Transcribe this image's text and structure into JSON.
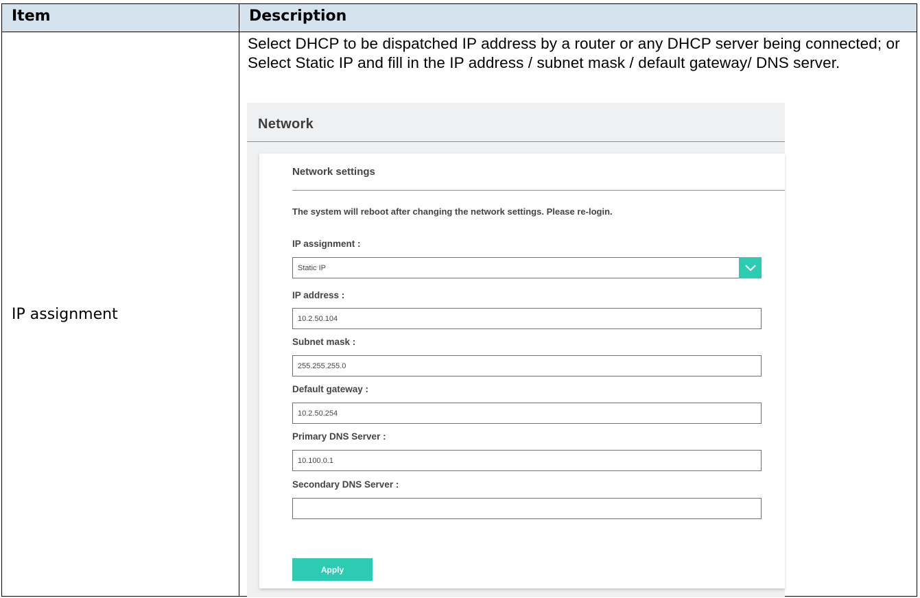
{
  "table": {
    "header_item": "Item",
    "header_description": "Description",
    "row_item": "IP assignment",
    "row_description": "Select DHCP to be dispatched IP address by a router or any DHCP server being connected; or Select Static IP and fill in the IP address / subnet mask / default gateway/ DNS server."
  },
  "screenshot": {
    "title": "Network",
    "card_title": "Network settings",
    "note": "The system will reboot after changing the network settings. Please re-login.",
    "ip_assignment_label": "IP assignment :",
    "ip_assignment_value": "Static IP",
    "ip_address_label": "IP address :",
    "ip_address_value": "10.2.50.104",
    "subnet_mask_label": "Subnet mask :",
    "subnet_mask_value": "255.255.255.0",
    "default_gateway_label": "Default gateway :",
    "default_gateway_value": "10.2.50.254",
    "primary_dns_label": "Primary DNS Server :",
    "primary_dns_value": "10.100.0.1",
    "secondary_dns_label": "Secondary DNS Server :",
    "secondary_dns_value": "",
    "apply_label": "Apply",
    "accent_color": "#2ecbb3",
    "header_color": "#d5e3ee"
  }
}
